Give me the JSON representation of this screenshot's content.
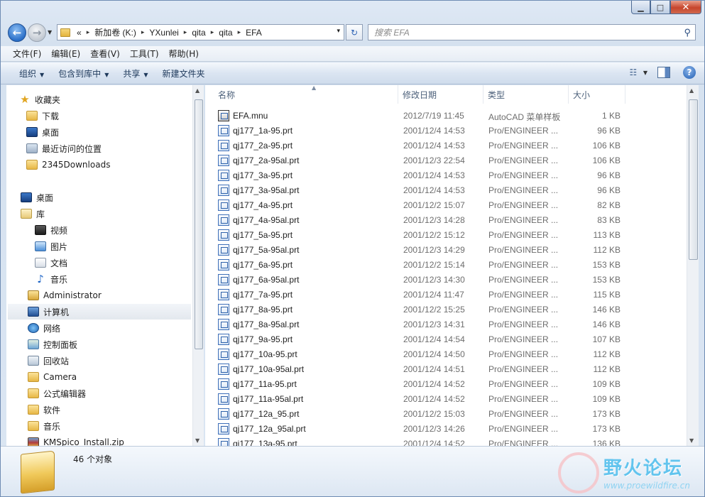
{
  "window": {
    "controls": {
      "minimize": "▁",
      "maximize": "□",
      "close": "✕"
    }
  },
  "address_bar": {
    "overflow": "«",
    "crumbs": [
      "新加卷 (K:)",
      "YXunlei",
      "qita",
      "qita",
      "EFA"
    ],
    "separator": "▸",
    "dropdown": "▾",
    "refresh": "↻"
  },
  "search": {
    "placeholder": "搜索 EFA",
    "icon": "search-icon"
  },
  "menu": [
    "文件(F)",
    "编辑(E)",
    "查看(V)",
    "工具(T)",
    "帮助(H)"
  ],
  "toolbar": {
    "organize": "组织",
    "include_in_library": "包含到库中",
    "share": "共享",
    "new_folder": "新建文件夹",
    "help": "?"
  },
  "nav_pane": {
    "favorites": [
      "收藏夹",
      "下载",
      "桌面",
      "最近访问的位置",
      "2345Downloads"
    ],
    "tree": [
      "桌面",
      "库",
      "视频",
      "图片",
      "文档",
      "音乐",
      "Administrator",
      "计算机",
      "网络",
      "控制面板",
      "回收站",
      "Camera",
      "公式编辑器",
      "软件",
      "音乐",
      "KMSpico_Install.zip"
    ],
    "selected": "计算机"
  },
  "columns": {
    "name": "名称",
    "date": "修改日期",
    "type": "类型",
    "size": "大小"
  },
  "files": [
    {
      "name": "EFA.mnu",
      "date": "2012/7/19 11:45",
      "type": "AutoCAD 菜单样板",
      "size": "1 KB"
    },
    {
      "name": "qj177_1a-95.prt",
      "date": "2001/12/4 14:53",
      "type": "Pro/ENGINEER ...",
      "size": "96 KB"
    },
    {
      "name": "qj177_2a-95.prt",
      "date": "2001/12/4 14:53",
      "type": "Pro/ENGINEER ...",
      "size": "106 KB"
    },
    {
      "name": "qj177_2a-95al.prt",
      "date": "2001/12/3 22:54",
      "type": "Pro/ENGINEER ...",
      "size": "106 KB"
    },
    {
      "name": "qj177_3a-95.prt",
      "date": "2001/12/4 14:53",
      "type": "Pro/ENGINEER ...",
      "size": "96 KB"
    },
    {
      "name": "qj177_3a-95al.prt",
      "date": "2001/12/4 14:53",
      "type": "Pro/ENGINEER ...",
      "size": "96 KB"
    },
    {
      "name": "qj177_4a-95.prt",
      "date": "2001/12/2 15:07",
      "type": "Pro/ENGINEER ...",
      "size": "82 KB"
    },
    {
      "name": "qj177_4a-95al.prt",
      "date": "2001/12/3 14:28",
      "type": "Pro/ENGINEER ...",
      "size": "83 KB"
    },
    {
      "name": "qj177_5a-95.prt",
      "date": "2001/12/2 15:12",
      "type": "Pro/ENGINEER ...",
      "size": "113 KB"
    },
    {
      "name": "qj177_5a-95al.prt",
      "date": "2001/12/3 14:29",
      "type": "Pro/ENGINEER ...",
      "size": "112 KB"
    },
    {
      "name": "qj177_6a-95.prt",
      "date": "2001/12/2 15:14",
      "type": "Pro/ENGINEER ...",
      "size": "153 KB"
    },
    {
      "name": "qj177_6a-95al.prt",
      "date": "2001/12/3 14:30",
      "type": "Pro/ENGINEER ...",
      "size": "153 KB"
    },
    {
      "name": "qj177_7a-95.prt",
      "date": "2001/12/4 11:47",
      "type": "Pro/ENGINEER ...",
      "size": "115 KB"
    },
    {
      "name": "qj177_8a-95.prt",
      "date": "2001/12/2 15:25",
      "type": "Pro/ENGINEER ...",
      "size": "146 KB"
    },
    {
      "name": "qj177_8a-95al.prt",
      "date": "2001/12/3 14:31",
      "type": "Pro/ENGINEER ...",
      "size": "146 KB"
    },
    {
      "name": "qj177_9a-95.prt",
      "date": "2001/12/4 14:54",
      "type": "Pro/ENGINEER ...",
      "size": "107 KB"
    },
    {
      "name": "qj177_10a-95.prt",
      "date": "2001/12/4 14:50",
      "type": "Pro/ENGINEER ...",
      "size": "112 KB"
    },
    {
      "name": "qj177_10a-95al.prt",
      "date": "2001/12/4 14:51",
      "type": "Pro/ENGINEER ...",
      "size": "112 KB"
    },
    {
      "name": "qj177_11a-95.prt",
      "date": "2001/12/4 14:52",
      "type": "Pro/ENGINEER ...",
      "size": "109 KB"
    },
    {
      "name": "qj177_11a-95al.prt",
      "date": "2001/12/4 14:52",
      "type": "Pro/ENGINEER ...",
      "size": "109 KB"
    },
    {
      "name": "qj177_12a_95.prt",
      "date": "2001/12/2 15:03",
      "type": "Pro/ENGINEER ...",
      "size": "173 KB"
    },
    {
      "name": "qj177_12a_95al.prt",
      "date": "2001/12/3 14:26",
      "type": "Pro/ENGINEER ...",
      "size": "173 KB"
    },
    {
      "name": "qj177_13a-95.prt",
      "date": "2001/12/4 14:52",
      "type": "Pro/ENGINEER ...",
      "size": "136 KB"
    }
  ],
  "details": {
    "count": "46 个对象"
  },
  "watermark": {
    "text": "野火论坛",
    "url": "www.proewildfire.cn"
  },
  "colors": {
    "accent": "#2a6fc8",
    "selection": "#e3e8ee",
    "watermark": "#62c4ee"
  }
}
